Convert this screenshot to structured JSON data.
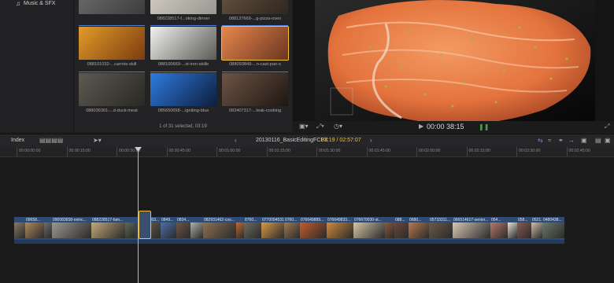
{
  "sidebar": {
    "items": [
      {
        "label": "Music & SFX",
        "icon": "music-note-icon"
      }
    ]
  },
  "browser": {
    "clips": [
      {
        "name": "",
        "colors": [
          "#6f6f6f",
          "#3d3d3d"
        ],
        "row": 0,
        "col": 0
      },
      {
        "name": "088228517-f...oking-dinner",
        "colors": [
          "#d6d2c9",
          "#9a9790"
        ],
        "row": 0,
        "col": 1
      },
      {
        "name": "088137669-...g-pizza-oven",
        "colors": [
          "#6a5742",
          "#2e2620"
        ],
        "row": 0,
        "col": 2
      },
      {
        "name": "088101032-...carrots-skill",
        "colors": [
          "#e39b2a",
          "#7a3c10"
        ],
        "row": 1,
        "col": 0
      },
      {
        "name": "088100669-...st-iron-skille",
        "colors": [
          "#f1f1ef",
          "#5b5a56"
        ],
        "row": 1,
        "col": 1
      },
      {
        "name": "088093849-...n-cast-pan-s",
        "colors": [
          "#e8874d",
          "#6a3520"
        ],
        "row": 1,
        "col": 2
      },
      {
        "name": "088036301-...d-duck-meat",
        "colors": [
          "#5e5a52",
          "#2a2824"
        ],
        "row": 2,
        "col": 0
      },
      {
        "name": "085650658-...igniting-blue",
        "colors": [
          "#2f7be0",
          "#0c1e3d"
        ],
        "row": 2,
        "col": 1
      },
      {
        "name": "083407317-...teak-cooking",
        "colors": [
          "#6d5545",
          "#1e1612"
        ],
        "row": 2,
        "col": 2
      }
    ],
    "status": "1 of 31 selected, 03:19"
  },
  "viewer": {
    "timecode": "00:00 38:15"
  },
  "timeline": {
    "toolbar": {
      "index_label": "Index",
      "project_name": "20130116_BasicEditingFCPX",
      "position": "03:19 / 02:57:07"
    },
    "ruler_ticks": [
      "00:00:00:00",
      "00:00:15:00",
      "00:00:30:00",
      "00:00:45:00",
      "00:01:00:00",
      "00:01:15:00",
      "00:01:30:00",
      "00:01:45:00",
      "00:02:00:00",
      "00:02:15:00",
      "00:02:30:00",
      "00:02:45:00",
      "00:03"
    ],
    "clips": [
      {
        "label": "",
        "w": 14,
        "color": "#8a7a62"
      },
      {
        "label": "09658...",
        "w": 24,
        "color": "#b08a5a"
      },
      {
        "label": "",
        "w": 10,
        "color": "#6d6d6d"
      },
      {
        "label": "090083658-oninc...",
        "w": 50,
        "color": "#9c9890"
      },
      {
        "label": "088228517-fam...",
        "w": 43,
        "color": "#c2a878"
      },
      {
        "label": "",
        "w": 12,
        "color": "#5f6a58"
      },
      {
        "label": "",
        "w": 12,
        "color": "#3f4b58"
      },
      {
        "label": "08663...",
        "w": 21,
        "color": "#6b5a48"
      },
      {
        "label": "0849...",
        "w": 20,
        "color": "#4d6fa8"
      },
      {
        "label": "0834...",
        "w": 18,
        "color": "#6d5545"
      },
      {
        "label": "",
        "w": 16,
        "color": "#b0b0a8"
      },
      {
        "label": "082931462-coo...",
        "w": 42,
        "color": "#8e7052"
      },
      {
        "label": "",
        "w": 10,
        "color": "#c26a32"
      },
      {
        "label": "8760...",
        "w": 22,
        "color": "#6f6a60"
      },
      {
        "label": "0770094531...",
        "w": 29,
        "color": "#d79b45"
      },
      {
        "label": "0760...",
        "w": 20,
        "color": "#a07a52"
      },
      {
        "label": "076649889...",
        "w": 34,
        "color": "#c45c28"
      },
      {
        "label": "076649833...",
        "w": 34,
        "color": "#cf8a3a"
      },
      {
        "label": "076670030-st...",
        "w": 40,
        "color": "#d4c6a6"
      },
      {
        "label": "",
        "w": 12,
        "color": "#8b5a3a"
      },
      {
        "label": "088...",
        "w": 18,
        "color": "#6a4a3a"
      },
      {
        "label": "0680...",
        "w": 26,
        "color": "#b87a4a"
      },
      {
        "label": "05733311...",
        "w": 30,
        "color": "#6b5a48"
      },
      {
        "label": "066514617-senior...",
        "w": 48,
        "color": "#d8c6b2"
      },
      {
        "label": "054...",
        "w": 22,
        "color": "#b47a6a"
      },
      {
        "label": "",
        "w": 12,
        "color": "#e6e1d6"
      },
      {
        "label": "058...",
        "w": 18,
        "color": "#8a5a52"
      },
      {
        "label": "0521...",
        "w": 14,
        "color": "#cfc0a8"
      },
      {
        "label": "0480438...",
        "w": 28,
        "color": "#6a7a6a"
      }
    ]
  },
  "colors": {
    "accent": "#f2c230",
    "clip_blue": "#2f4b74",
    "selection_blue": "#4a7fd6"
  }
}
